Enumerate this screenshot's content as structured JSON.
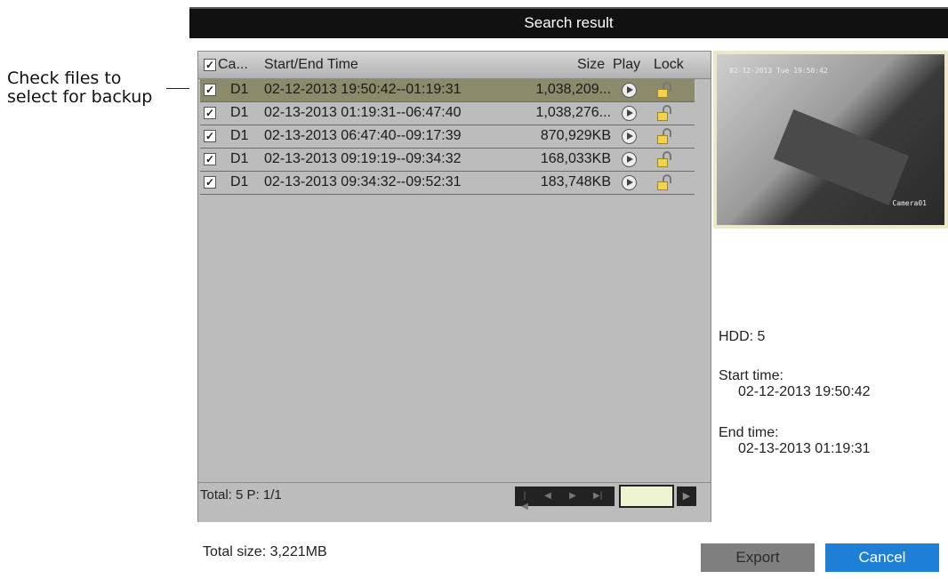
{
  "annotation": {
    "line1": "Check files to",
    "line2": "select for backup"
  },
  "window": {
    "title": "Search result"
  },
  "table": {
    "headers": {
      "camera": "Ca...",
      "time": "Start/End Time",
      "size": "Size",
      "play": "Play",
      "lock": "Lock"
    },
    "rows": [
      {
        "camera": "D1",
        "time": "02-12-2013 19:50:42--01:19:31",
        "size": "1,038,209...",
        "checked": true,
        "selected": true
      },
      {
        "camera": "D1",
        "time": "02-13-2013 01:19:31--06:47:40",
        "size": "1,038,276...",
        "checked": true,
        "selected": false
      },
      {
        "camera": "D1",
        "time": "02-13-2013 06:47:40--09:17:39",
        "size": "870,929KB",
        "checked": true,
        "selected": false
      },
      {
        "camera": "D1",
        "time": "02-13-2013 09:19:19--09:34:32",
        "size": "168,033KB",
        "checked": true,
        "selected": false
      },
      {
        "camera": "D1",
        "time": "02-13-2013 09:34:32--09:52:31",
        "size": "183,748KB",
        "checked": true,
        "selected": false
      }
    ],
    "footer": {
      "total": "Total: 5  P: 1/1"
    }
  },
  "preview": {
    "timestamp": "02-12-2013 Tue 19:50:42",
    "camera_name": "Camera01"
  },
  "info": {
    "hdd": "HDD: 5",
    "start_label": "Start time:",
    "start_value": "02-12-2013 19:50:42",
    "end_label": "End time:",
    "end_value": "02-13-2013 01:19:31"
  },
  "summary": {
    "total_size": "Total size: 3,221MB"
  },
  "buttons": {
    "export": "Export",
    "cancel": "Cancel"
  },
  "colors": {
    "accent": "#1d7fd6",
    "selected_row": "#8b8a6b"
  }
}
